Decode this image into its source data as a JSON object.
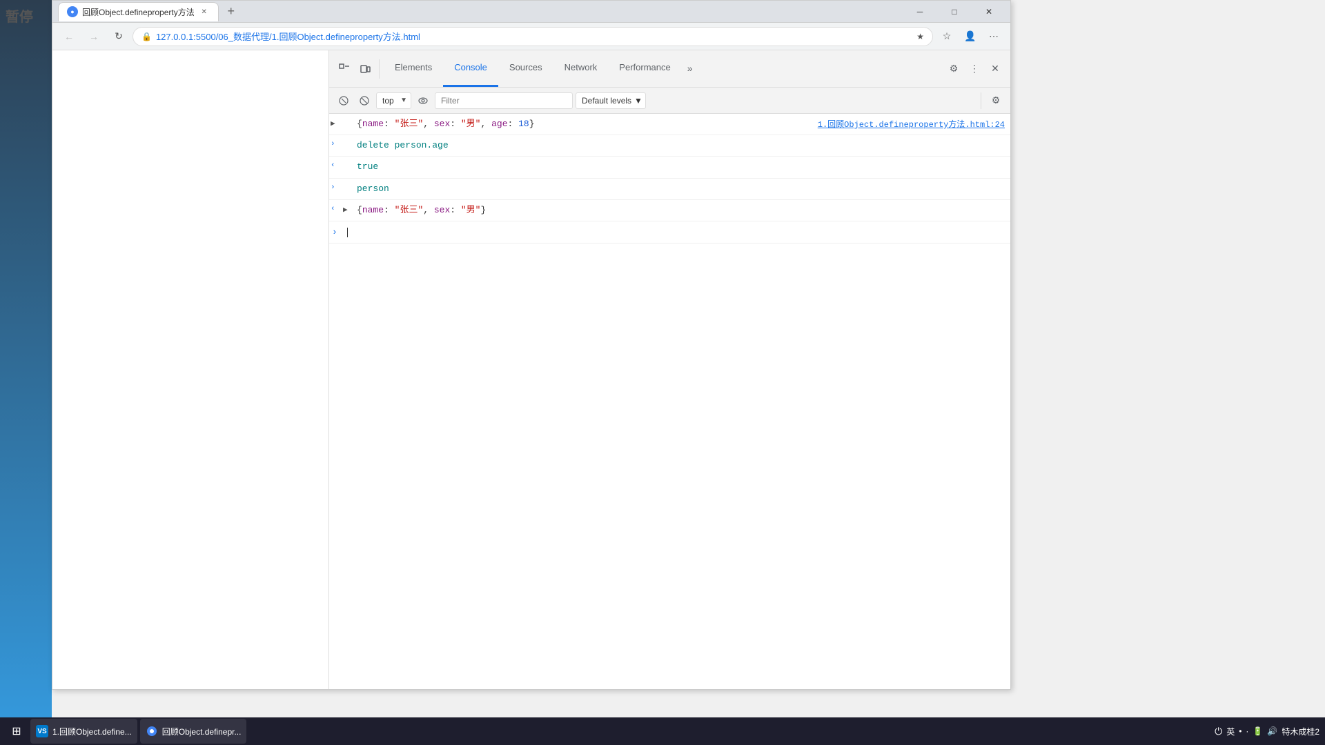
{
  "watermark": {
    "text": "暂停"
  },
  "browser": {
    "tab": {
      "title": "回顾Object.defineproperty方法",
      "favicon_text": "○"
    },
    "address": "127.0.0.1:5500/06_数据代理/1.回顾Object.defineproperty方法.html",
    "new_tab_label": "+"
  },
  "window_controls": {
    "minimize": "─",
    "maximize": "□",
    "close": "✕"
  },
  "nav": {
    "back_disabled": true,
    "forward_disabled": true
  },
  "devtools": {
    "tabs": [
      {
        "id": "elements",
        "label": "Elements",
        "active": false
      },
      {
        "id": "console",
        "label": "Console",
        "active": true
      },
      {
        "id": "sources",
        "label": "Sources",
        "active": false
      },
      {
        "id": "network",
        "label": "Network",
        "active": false
      },
      {
        "id": "performance",
        "label": "Performance",
        "active": false
      }
    ],
    "more_tabs_label": "»",
    "console_context": "top",
    "filter_placeholder": "Filter",
    "default_levels_label": "Default levels",
    "settings_icon": "⚙",
    "more_icon": "⋮",
    "close_icon": "✕"
  },
  "console": {
    "lines": [
      {
        "id": "line1",
        "type": "output-expand",
        "left_arrow": "▶",
        "left_gutter": "",
        "content_html": "{<span class='key-val'>name</span>: <span class='str-val'>\"张三\"</span>, <span class='key-val'>sex</span>: <span class='str-val'>\"男\"</span>, <span class='key-val'>age</span>: <span class='num-val'>18</span>}",
        "source": "1.回顾Object.defineproperty方法.html:24",
        "source_href": "#"
      },
      {
        "id": "line2",
        "type": "input",
        "left_arrow": ">",
        "left_gutter": "",
        "content": "delete person.age",
        "content_class": "color-teal"
      },
      {
        "id": "line3",
        "type": "output",
        "left_arrow": "<",
        "left_gutter": "",
        "content": "true",
        "content_class": "color-teal"
      },
      {
        "id": "line4",
        "type": "input",
        "left_arrow": ">",
        "left_gutter": "",
        "content": "person",
        "content_class": "color-teal"
      },
      {
        "id": "line5",
        "type": "output-expand",
        "left_arrow": "<",
        "left_gutter": "▶",
        "content_html": "{<span class='key-val'>name</span>: <span class='str-val'>\"张三\"</span>, <span class='key-val'>sex</span>: <span class='str-val'>\"男\"</span>}",
        "source": "",
        "source_href": ""
      }
    ],
    "input_prompt": ">",
    "cursor_char": "|"
  },
  "taskbar": {
    "start_icon": "⊞",
    "items": [
      {
        "id": "vscode",
        "icon": "VS",
        "icon_color": "#007acc",
        "label": "1.回顾Object.define..."
      },
      {
        "id": "chrome",
        "icon": "C",
        "icon_color": "#4285f4",
        "label": "回顾Object.definepr..."
      }
    ],
    "system_tray": {
      "items": [
        "英",
        "•",
        "·",
        "⬜",
        "⬛",
        "■"
      ],
      "icons": "⏻ 英 · ⬜ ■ ⬛"
    },
    "time": "特木成桂2"
  }
}
